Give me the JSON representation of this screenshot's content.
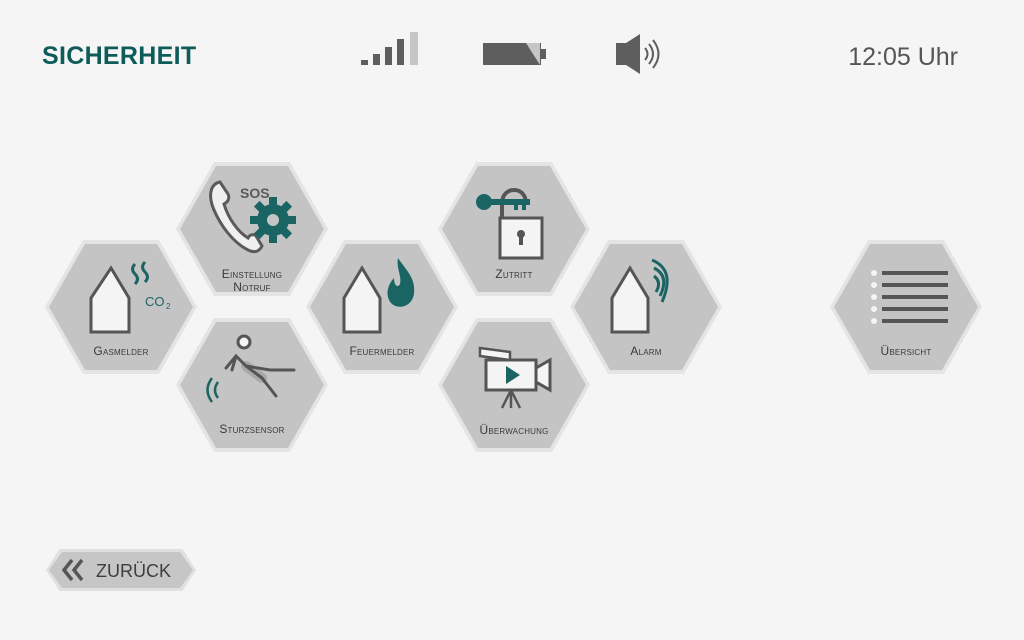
{
  "header": {
    "title": "SICHERHEIT",
    "clock": "12:05 Uhr",
    "signal_icon": "signal-icon",
    "battery_icon": "battery-icon",
    "volume_icon": "volume-icon"
  },
  "tiles": [
    {
      "id": "einstellung-notruf",
      "line1": "Einstellung",
      "line2": "Notruf",
      "icon": "sos-phone-gear-icon"
    },
    {
      "id": "gasmelder",
      "line1": "Gasmelder",
      "line2": "",
      "icon": "gas-house-icon",
      "co2": "CO",
      "co2_sub": "2"
    },
    {
      "id": "sturzsensor",
      "line1": "Sturzsensor",
      "line2": "",
      "icon": "fall-person-icon"
    },
    {
      "id": "feuermelder",
      "line1": "Feuermelder",
      "line2": "",
      "icon": "fire-house-icon"
    },
    {
      "id": "zutritt",
      "line1": "Zutritt",
      "line2": "",
      "icon": "key-lock-icon"
    },
    {
      "id": "ueberwachung",
      "line1": "Überwachung",
      "line2": "",
      "icon": "camera-icon"
    },
    {
      "id": "alarm",
      "line1": "Alarm",
      "line2": "",
      "icon": "alarm-house-icon"
    },
    {
      "id": "uebersicht",
      "line1": "Übersicht",
      "line2": "",
      "icon": "list-icon"
    }
  ],
  "back_button": {
    "label": "ZURÜCK",
    "icon": "double-chevron-left-icon"
  },
  "colors": {
    "accent": "#0e5c5a",
    "tile": "#c4c4c4",
    "tile_border": "#e4e4e4",
    "icon_gray": "#5a5a5a",
    "background": "#f5f5f5"
  }
}
